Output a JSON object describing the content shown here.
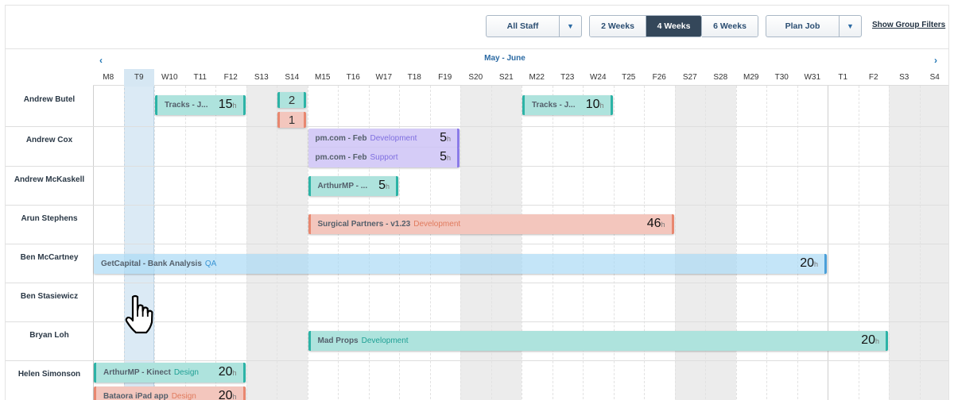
{
  "toolbar": {
    "staff_filter": "All Staff",
    "range_options": [
      "2 Weeks",
      "4 Weeks",
      "6 Weeks"
    ],
    "range_active": "4 Weeks",
    "plan_job": "Plan Job",
    "show_group_filters": "Show Group Filters",
    "dropdown_arrow": "▼"
  },
  "calendar": {
    "month_label": "May - June",
    "prev_arrow": "‹",
    "next_arrow": "›",
    "days": [
      "M8",
      "T9",
      "W10",
      "T11",
      "F12",
      "S13",
      "S14",
      "M15",
      "T16",
      "W17",
      "T18",
      "F19",
      "S20",
      "S21",
      "M22",
      "T23",
      "W24",
      "T25",
      "F26",
      "S27",
      "S28",
      "M29",
      "T30",
      "W31",
      "T1",
      "F2",
      "S3",
      "S4"
    ],
    "today": "T9"
  },
  "people": [
    {
      "name": "Andrew Butel"
    },
    {
      "name": "Andrew Cox"
    },
    {
      "name": "Andrew McKaskell"
    },
    {
      "name": "Arun Stephens"
    },
    {
      "name": "Ben McCartney"
    },
    {
      "name": "Ben Stasiewicz"
    },
    {
      "name": "Bryan Loh"
    },
    {
      "name": "Helen Simonson"
    }
  ],
  "bookings": [
    {
      "id": "b1",
      "job": "Tracks - J...",
      "tag": "",
      "hours": "15",
      "unit": "h"
    },
    {
      "id": "b2",
      "job": "Tracks - J...",
      "tag": "",
      "hours": "10",
      "unit": "h"
    },
    {
      "id": "b3",
      "job": "pm.com - Feb",
      "tag": "Development",
      "hours": "5",
      "unit": "h"
    },
    {
      "id": "b4",
      "job": "pm.com - Feb",
      "tag": "Support",
      "hours": "5",
      "unit": "h"
    },
    {
      "id": "b5",
      "job": "ArthurMP - ...",
      "tag": "",
      "hours": "5",
      "unit": "h"
    },
    {
      "id": "b6",
      "job": "Surgical Partners - v1.23",
      "tag": "Development",
      "hours": "46",
      "unit": "h"
    },
    {
      "id": "b7",
      "job": "GetCapital - Bank Analysis",
      "tag": "QA",
      "hours": "20",
      "unit": "h"
    },
    {
      "id": "b8",
      "job": "Mad Props",
      "tag": "Development",
      "hours": "20",
      "unit": "h"
    },
    {
      "id": "b9",
      "job": "ArthurMP - Kinect",
      "tag": "Design",
      "hours": "20",
      "unit": "h"
    },
    {
      "id": "b10",
      "job": "Bataora iPad app",
      "tag": "Design",
      "hours": "20",
      "unit": "h"
    }
  ],
  "chips": [
    {
      "id": "c1",
      "value": "2"
    },
    {
      "id": "c2",
      "value": "1"
    }
  ]
}
